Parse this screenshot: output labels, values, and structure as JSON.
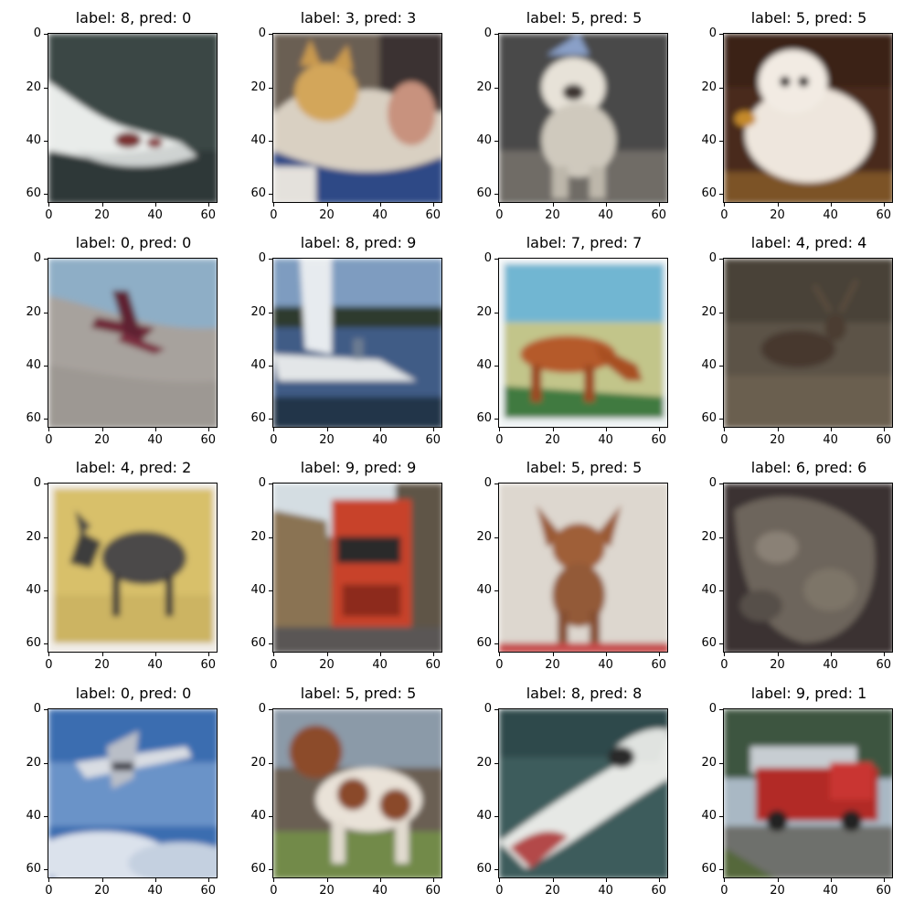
{
  "figure": {
    "x_ticks": [
      "0",
      "20",
      "40",
      "60"
    ],
    "y_ticks": [
      "0",
      "20",
      "40",
      "60"
    ],
    "panels": [
      {
        "title": "label: 8, pred: 0",
        "scene": "boat-white"
      },
      {
        "title": "label: 3, pred: 3",
        "scene": "cat"
      },
      {
        "title": "label: 5, pred: 5",
        "scene": "dog-white-small"
      },
      {
        "title": "label: 5, pred: 5",
        "scene": "dog-white-fluffy"
      },
      {
        "title": "label: 0, pred: 0",
        "scene": "biplane"
      },
      {
        "title": "label: 8, pred: 9",
        "scene": "sailboat"
      },
      {
        "title": "label: 7, pred: 7",
        "scene": "horse"
      },
      {
        "title": "label: 4, pred: 4",
        "scene": "deer-dark"
      },
      {
        "title": "label: 4, pred: 2",
        "scene": "moose"
      },
      {
        "title": "label: 9, pred: 9",
        "scene": "truck-orange"
      },
      {
        "title": "label: 5, pred: 5",
        "scene": "chihuahua"
      },
      {
        "title": "label: 6, pred: 6",
        "scene": "frog"
      },
      {
        "title": "label: 0, pred: 0",
        "scene": "airplane-sky"
      },
      {
        "title": "label: 5, pred: 5",
        "scene": "spaniel"
      },
      {
        "title": "label: 8, pred: 8",
        "scene": "speedboat"
      },
      {
        "title": "label: 9, pred: 1",
        "scene": "firetruck"
      }
    ]
  }
}
